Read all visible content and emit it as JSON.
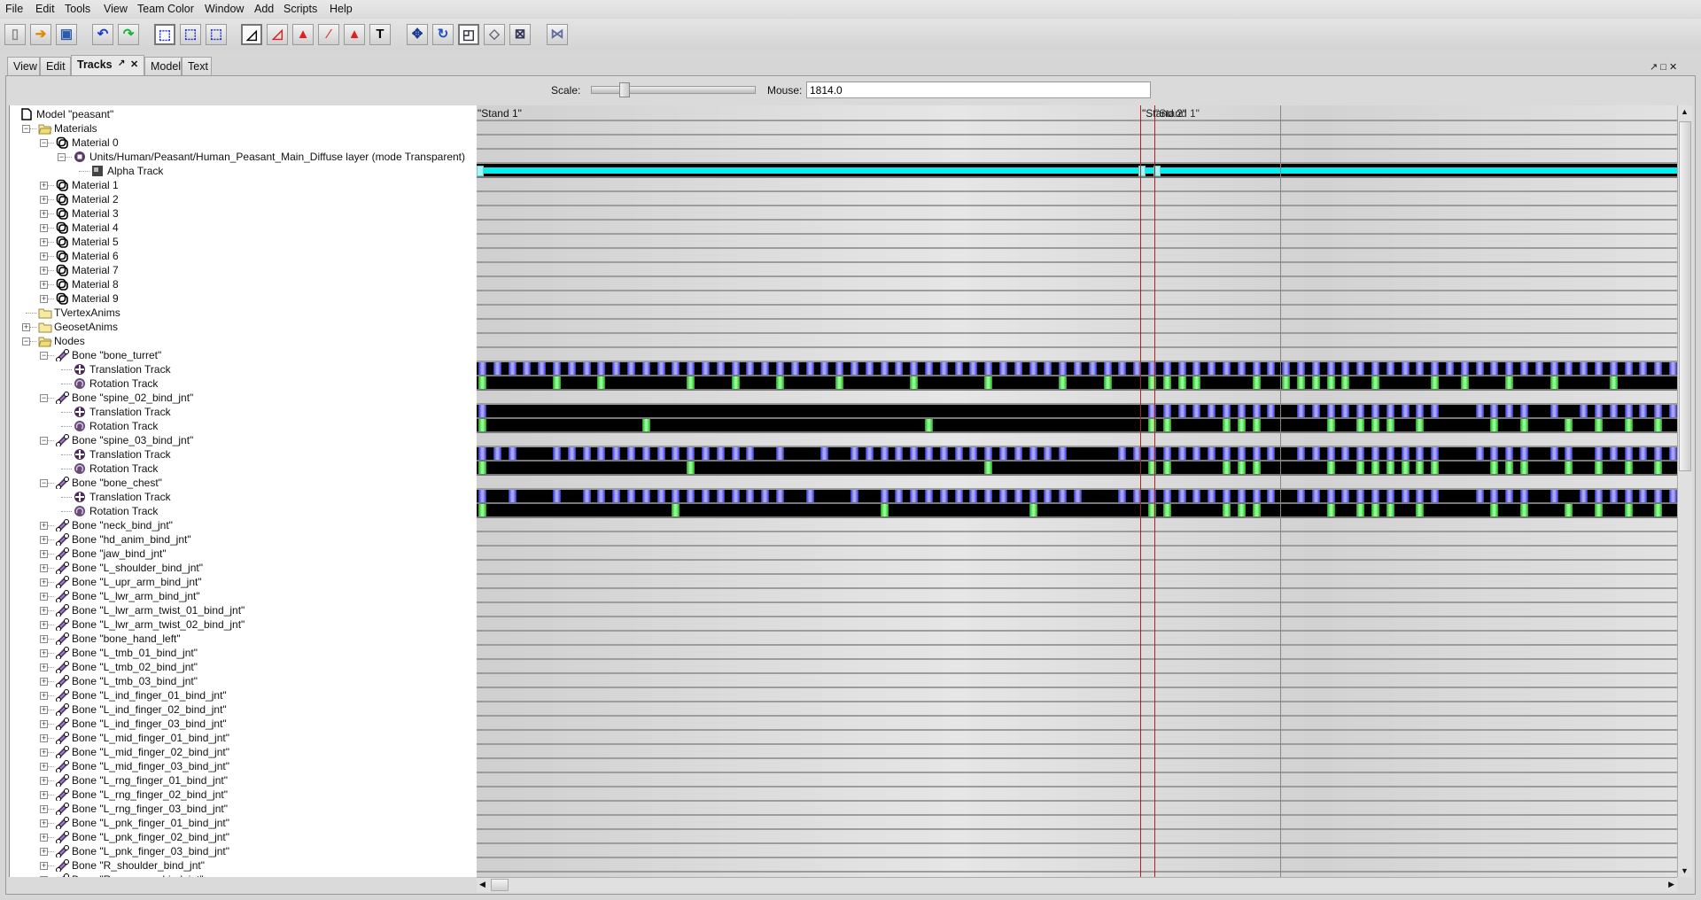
{
  "menu": [
    "File",
    "Edit",
    "Tools",
    "View",
    "Team Color",
    "Window",
    "Add",
    "Scripts",
    "Help"
  ],
  "toolbar": [
    {
      "icon": "new-file-icon",
      "glyph": "▯"
    },
    {
      "icon": "open-file-icon",
      "glyph": "➔"
    },
    {
      "icon": "save-icon",
      "glyph": "▣"
    },
    {
      "icon": "undo-icon",
      "glyph": "↶"
    },
    {
      "icon": "redo-icon",
      "glyph": "↷"
    },
    {
      "icon": "select-icon",
      "glyph": "⬚"
    },
    {
      "icon": "add-select-icon",
      "glyph": "⬚"
    },
    {
      "icon": "deselect-icon",
      "glyph": "⬚"
    },
    {
      "icon": "select-vertices-icon",
      "glyph": "◿"
    },
    {
      "icon": "select-faces-icon",
      "glyph": "◿"
    },
    {
      "icon": "select-geoset-icon",
      "glyph": "▲"
    },
    {
      "icon": "select-particles-icon",
      "glyph": "⁄"
    },
    {
      "icon": "select-mesh-icon",
      "glyph": "▲"
    },
    {
      "icon": "text-icon",
      "glyph": "T"
    },
    {
      "icon": "move-icon",
      "glyph": "✥"
    },
    {
      "icon": "rotate-icon",
      "glyph": "↻"
    },
    {
      "icon": "scale-icon",
      "glyph": "◰"
    },
    {
      "icon": "extrude-icon",
      "glyph": "◇"
    },
    {
      "icon": "mirror-icon",
      "glyph": "⊠"
    },
    {
      "icon": "snap-icon",
      "glyph": "⋈"
    }
  ],
  "tabs": [
    "View",
    "Edit",
    "Tracks",
    "Model",
    "Text"
  ],
  "active_tab": "Tracks",
  "tab_controls": {
    "undock": "↗",
    "close": "✕"
  },
  "window_controls": {
    "undock": "↗",
    "maximize": "□",
    "close": "✕"
  },
  "scale": {
    "label": "Scale:",
    "value": 0.18
  },
  "mouse": {
    "label": "Mouse:",
    "value": "1814.0"
  },
  "sequences": [
    {
      "label": "\"Stand 1\""
    },
    {
      "label": "\"Stand 2\""
    },
    {
      "label": "\"Stand 1\""
    }
  ],
  "tree": [
    {
      "d": 0,
      "e": "",
      "i": "doc",
      "t": "Model \"peasant\""
    },
    {
      "d": 1,
      "e": "-",
      "i": "folder-open",
      "t": "Materials"
    },
    {
      "d": 2,
      "e": "-",
      "i": "material",
      "t": "Material 0"
    },
    {
      "d": 3,
      "e": "-",
      "i": "layer",
      "t": "Units/Human/Peasant/Human_Peasant_Main_Diffuse layer (mode Transparent)"
    },
    {
      "d": 4,
      "e": "",
      "i": "alpha",
      "t": "Alpha Track",
      "track": "alpha",
      "keys": "0,45,46"
    },
    {
      "d": 2,
      "e": "+",
      "i": "material",
      "t": "Material 1"
    },
    {
      "d": 2,
      "e": "+",
      "i": "material",
      "t": "Material 2"
    },
    {
      "d": 2,
      "e": "+",
      "i": "material",
      "t": "Material 3"
    },
    {
      "d": 2,
      "e": "+",
      "i": "material",
      "t": "Material 4"
    },
    {
      "d": 2,
      "e": "+",
      "i": "material",
      "t": "Material 5"
    },
    {
      "d": 2,
      "e": "+",
      "i": "material",
      "t": "Material 6"
    },
    {
      "d": 2,
      "e": "+",
      "i": "material",
      "t": "Material 7"
    },
    {
      "d": 2,
      "e": "+",
      "i": "material",
      "t": "Material 8"
    },
    {
      "d": 2,
      "e": "+",
      "i": "material",
      "t": "Material 9"
    },
    {
      "d": 1,
      "e": "",
      "i": "folder",
      "t": "TVertexAnims"
    },
    {
      "d": 1,
      "e": "+",
      "i": "folder",
      "t": "GeosetAnims"
    },
    {
      "d": 1,
      "e": "-",
      "i": "folder-open",
      "t": "Nodes"
    },
    {
      "d": 2,
      "e": "-",
      "i": "bone",
      "t": "Bone \"bone_turret\""
    },
    {
      "d": 3,
      "e": "",
      "i": "translation",
      "t": "Translation Track",
      "track": "translation",
      "keys": "0-80"
    },
    {
      "d": 3,
      "e": "",
      "i": "rotation",
      "t": "Rotation Track",
      "track": "rotation",
      "keys": "0,5,8,14,17,20,24,29,34,39,42,45,46,47,48,52,54,55,56,57,58,60,64,66,69,72,76"
    },
    {
      "d": 2,
      "e": "-",
      "i": "bone",
      "t": "Bone \"spine_02_bind_jnt\""
    },
    {
      "d": 3,
      "e": "",
      "i": "translation",
      "t": "Translation Track",
      "track": "translation",
      "keys": "0,45-53,55-64,67-70,72,74-80"
    },
    {
      "d": 3,
      "e": "",
      "i": "rotation",
      "t": "Rotation Track",
      "track": "rotation",
      "keys": "0,11,30,45,46,50,51,52,57,59,60,61,63,68,70,73,75,77,79"
    },
    {
      "d": 2,
      "e": "-",
      "i": "bone",
      "t": "Bone \"spine_03_bind_jnt\""
    },
    {
      "d": 3,
      "e": "",
      "i": "translation",
      "t": "Translation Track",
      "track": "translation",
      "keys": "0-2,5-18,20,23,25-39,43-53,55-64,67-70,72,73,75-80"
    },
    {
      "d": 3,
      "e": "",
      "i": "rotation",
      "t": "Rotation Track",
      "track": "rotation",
      "keys": "0,14,34,45,46,50,51,52,57,59-64,68,69,70,73,75,77,79"
    },
    {
      "d": 2,
      "e": "-",
      "i": "bone",
      "t": "Bone \"bone_chest\""
    },
    {
      "d": 3,
      "e": "",
      "i": "translation",
      "t": "Translation Track",
      "track": "translation",
      "keys": "0,2,5,7-20,22,25,27-40,43-53,55-64,67-70,72,74-80"
    },
    {
      "d": 3,
      "e": "",
      "i": "rotation",
      "t": "Rotation Track",
      "track": "rotation",
      "keys": "0,13,27,37,45,46,50,51,52,57,59,60,61,63,68,70,73,75,77,79"
    },
    {
      "d": 2,
      "e": "+",
      "i": "bone",
      "t": "Bone \"neck_bind_jnt\""
    },
    {
      "d": 2,
      "e": "+",
      "i": "bone",
      "t": "Bone \"hd_anim_bind_jnt\""
    },
    {
      "d": 2,
      "e": "+",
      "i": "bone",
      "t": "Bone \"jaw_bind_jnt\""
    },
    {
      "d": 2,
      "e": "+",
      "i": "bone",
      "t": "Bone \"L_shoulder_bind_jnt\""
    },
    {
      "d": 2,
      "e": "+",
      "i": "bone",
      "t": "Bone \"L_upr_arm_bind_jnt\""
    },
    {
      "d": 2,
      "e": "+",
      "i": "bone",
      "t": "Bone \"L_lwr_arm_bind_jnt\""
    },
    {
      "d": 2,
      "e": "+",
      "i": "bone",
      "t": "Bone \"L_lwr_arm_twist_01_bind_jnt\""
    },
    {
      "d": 2,
      "e": "+",
      "i": "bone",
      "t": "Bone \"L_lwr_arm_twist_02_bind_jnt\""
    },
    {
      "d": 2,
      "e": "+",
      "i": "bone",
      "t": "Bone \"bone_hand_left\""
    },
    {
      "d": 2,
      "e": "+",
      "i": "bone",
      "t": "Bone \"L_tmb_01_bind_jnt\""
    },
    {
      "d": 2,
      "e": "+",
      "i": "bone",
      "t": "Bone \"L_tmb_02_bind_jnt\""
    },
    {
      "d": 2,
      "e": "+",
      "i": "bone",
      "t": "Bone \"L_tmb_03_bind_jnt\""
    },
    {
      "d": 2,
      "e": "+",
      "i": "bone",
      "t": "Bone \"L_ind_finger_01_bind_jnt\""
    },
    {
      "d": 2,
      "e": "+",
      "i": "bone",
      "t": "Bone \"L_ind_finger_02_bind_jnt\""
    },
    {
      "d": 2,
      "e": "+",
      "i": "bone",
      "t": "Bone \"L_ind_finger_03_bind_jnt\""
    },
    {
      "d": 2,
      "e": "+",
      "i": "bone",
      "t": "Bone \"L_mid_finger_01_bind_jnt\""
    },
    {
      "d": 2,
      "e": "+",
      "i": "bone",
      "t": "Bone \"L_mid_finger_02_bind_jnt\""
    },
    {
      "d": 2,
      "e": "+",
      "i": "bone",
      "t": "Bone \"L_mid_finger_03_bind_jnt\""
    },
    {
      "d": 2,
      "e": "+",
      "i": "bone",
      "t": "Bone \"L_rng_finger_01_bind_jnt\""
    },
    {
      "d": 2,
      "e": "+",
      "i": "bone",
      "t": "Bone \"L_rng_finger_02_bind_jnt\""
    },
    {
      "d": 2,
      "e": "+",
      "i": "bone",
      "t": "Bone \"L_rng_finger_03_bind_jnt\""
    },
    {
      "d": 2,
      "e": "+",
      "i": "bone",
      "t": "Bone \"L_pnk_finger_01_bind_jnt\""
    },
    {
      "d": 2,
      "e": "+",
      "i": "bone",
      "t": "Bone \"L_pnk_finger_02_bind_jnt\""
    },
    {
      "d": 2,
      "e": "+",
      "i": "bone",
      "t": "Bone \"L_pnk_finger_03_bind_jnt\""
    },
    {
      "d": 2,
      "e": "+",
      "i": "bone",
      "t": "Bone \"R_shoulder_bind_jnt\""
    },
    {
      "d": 2,
      "e": "+",
      "i": "bone",
      "t": "Bone \"R_upr_arm_bind_jnt\""
    }
  ],
  "colors": {
    "translation_key": "#a8a8ff",
    "rotation_key": "#90ff90",
    "alpha_track": "#00f0f0",
    "sequence_marker": "#b02020",
    "track_bg": "#000000"
  }
}
